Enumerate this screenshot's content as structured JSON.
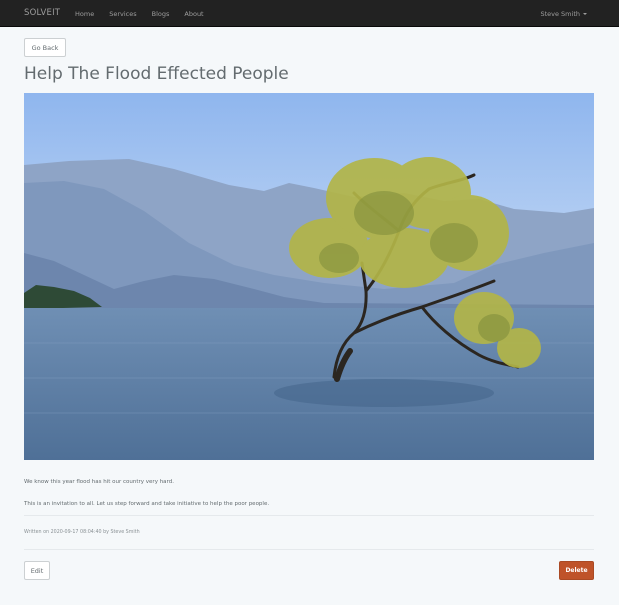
{
  "navbar": {
    "brand": "SOLVEIT",
    "links": [
      "Home",
      "Services",
      "Blogs",
      "About"
    ],
    "user_name": "Steve Smith"
  },
  "actions": {
    "go_back": "Go Back",
    "edit": "Edit",
    "delete": "Delete"
  },
  "post": {
    "title": "Help The Flood Effected People",
    "image_alt": "Lone tree standing in lake water with mountains in the background",
    "paragraphs": [
      "We know this year flood has hit our country very hard.",
      "This is an invitation to all. Let us step forward and take initiative to help the poor people."
    ],
    "meta": "Written on 2020-09-17 08:04:40 by Steve Smith"
  },
  "colors": {
    "navbar_bg": "#222222",
    "page_bg": "#f5f8fa",
    "danger": "#bf5329"
  }
}
